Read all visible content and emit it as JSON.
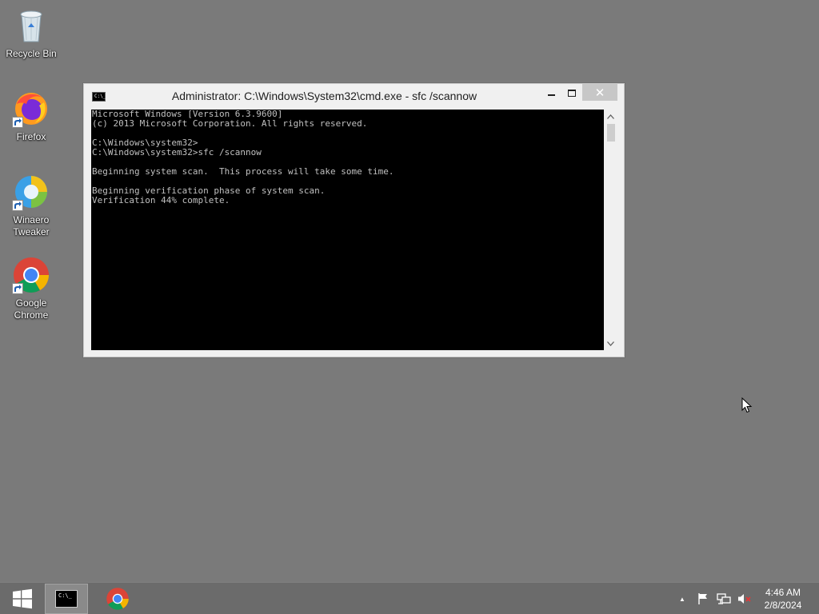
{
  "desktop": {
    "icons": [
      {
        "label": "Recycle Bin"
      },
      {
        "label": "Firefox"
      },
      {
        "label": "Winaero\nTweaker"
      },
      {
        "label": "Google\nChrome"
      }
    ]
  },
  "window": {
    "title": "Administrator: C:\\Windows\\System32\\cmd.exe - sfc  /scannow",
    "console_lines": [
      "Microsoft Windows [Version 6.3.9600]",
      "(c) 2013 Microsoft Corporation. All rights reserved.",
      "",
      "C:\\Windows\\system32>",
      "C:\\Windows\\system32>sfc /scannow",
      "",
      "Beginning system scan.  This process will take some time.",
      "",
      "Beginning verification phase of system scan.",
      "Verification 44% complete."
    ],
    "close_glyph": "✕"
  },
  "taskbar": {
    "cmd_icon_text": "C:\\_",
    "tray": {
      "show_hidden": "▲"
    },
    "clock": {
      "time": "4:46 AM",
      "date": "2/8/2024"
    }
  },
  "colors": {
    "desktop": "#7a7a7a",
    "taskbar": "#6b6b6b",
    "console_bg": "#000000",
    "console_text": "#c0c0c0",
    "close_button": "#c7c7c7"
  }
}
